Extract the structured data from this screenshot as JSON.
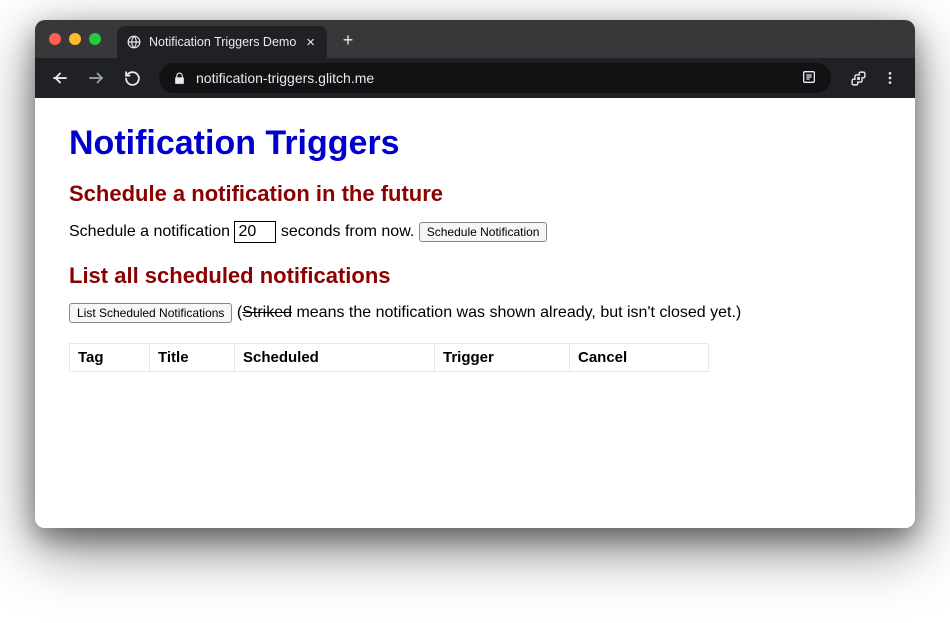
{
  "browser": {
    "tab_title": "Notification Triggers Demo",
    "url": "notification-triggers.glitch.me"
  },
  "page": {
    "h1": "Notification Triggers",
    "section1": {
      "heading": "Schedule a notification in the future",
      "label_before": "Schedule a notification ",
      "seconds_value": "20",
      "label_after": " seconds from now. ",
      "button": "Schedule Notification"
    },
    "section2": {
      "heading": "List all scheduled notifications",
      "button": "List Scheduled Notifications",
      "note_open": " (",
      "note_struck": "Striked",
      "note_rest": " means the notification was shown already, but isn't closed yet.)",
      "columns": {
        "tag": "Tag",
        "title": "Title",
        "scheduled": "Scheduled",
        "trigger": "Trigger",
        "cancel": "Cancel"
      }
    }
  }
}
